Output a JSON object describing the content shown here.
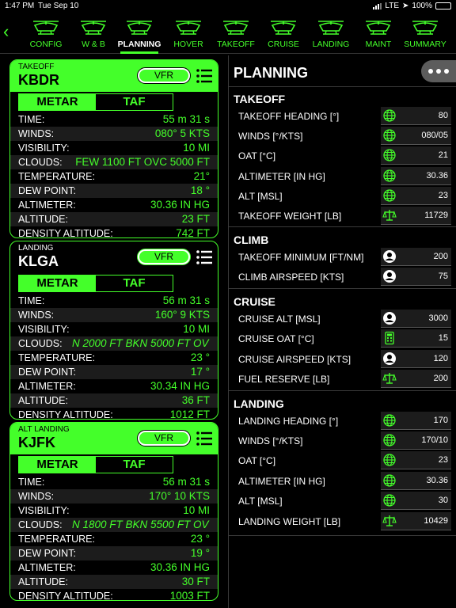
{
  "status": {
    "time": "1:47 PM",
    "date": "Tue Sep 10",
    "network": "LTE",
    "battery": "100%"
  },
  "nav": {
    "tabs": [
      {
        "label": "CONFIG",
        "icon": "helicopter-config-icon"
      },
      {
        "label": "W & B",
        "icon": "helicopter-weight-icon"
      },
      {
        "label": "PLANNING",
        "icon": "helicopter-planning-icon",
        "active": true
      },
      {
        "label": "HOVER",
        "icon": "helicopter-hover-icon"
      },
      {
        "label": "TAKEOFF",
        "icon": "helicopter-takeoff-icon"
      },
      {
        "label": "CRUISE",
        "icon": "helicopter-cruise-icon"
      },
      {
        "label": "LANDING",
        "icon": "helicopter-landing-icon"
      },
      {
        "label": "MAINT",
        "icon": "helicopter-maint-icon"
      },
      {
        "label": "SUMMARY",
        "icon": "helicopter-summary-icon"
      }
    ]
  },
  "weather": {
    "cards": [
      {
        "sub": "TAKEOFF",
        "code": "KBDR",
        "rules": "VFR",
        "metar": "METAR",
        "taf": "TAF",
        "highlight": true,
        "rows": [
          {
            "k": "TIME:",
            "v": "55 m 31 s"
          },
          {
            "k": "WINDS:",
            "v": "080° 5 KTS"
          },
          {
            "k": "VISIBILITY:",
            "v": "10 MI"
          },
          {
            "k": "CLOUDS:",
            "v": "FEW 1100 FT OVC 5000 FT"
          },
          {
            "k": "TEMPERATURE:",
            "v": "21°"
          },
          {
            "k": "DEW POINT:",
            "v": "18 °"
          },
          {
            "k": "ALTIMETER:",
            "v": "30.36 IN HG"
          },
          {
            "k": "ALTITUDE:",
            "v": "23 FT"
          },
          {
            "k": "DENSITY ALTITUDE:",
            "v": "742 FT"
          }
        ]
      },
      {
        "sub": "LANDING",
        "code": "KLGA",
        "rules": "VFR",
        "metar": "METAR",
        "taf": "TAF",
        "highlight": false,
        "rows": [
          {
            "k": "TIME:",
            "v": "56 m 31 s"
          },
          {
            "k": "WINDS:",
            "v": "160° 9 KTS"
          },
          {
            "k": "VISIBILITY:",
            "v": "10 MI"
          },
          {
            "k": "CLOUDS:",
            "v": "N 2000 FT BKN 5000 FT OV"
          },
          {
            "k": "TEMPERATURE:",
            "v": "23 °"
          },
          {
            "k": "DEW POINT:",
            "v": "17 °"
          },
          {
            "k": "ALTIMETER:",
            "v": "30.34 IN HG"
          },
          {
            "k": "ALTITUDE:",
            "v": "36 FT"
          },
          {
            "k": "DENSITY ALTITUDE:",
            "v": "1012 FT"
          }
        ]
      },
      {
        "sub": "ALT LANDING",
        "code": "KJFK",
        "rules": "VFR",
        "metar": "METAR",
        "taf": "TAF",
        "highlight": true,
        "rows": [
          {
            "k": "TIME:",
            "v": "56 m 31 s"
          },
          {
            "k": "WINDS:",
            "v": "170° 10 KTS"
          },
          {
            "k": "VISIBILITY:",
            "v": "10 MI"
          },
          {
            "k": "CLOUDS:",
            "v": "N 1800 FT BKN 5500 FT OV"
          },
          {
            "k": "TEMPERATURE:",
            "v": "23 °"
          },
          {
            "k": "DEW POINT:",
            "v": "19 °"
          },
          {
            "k": "ALTIMETER:",
            "v": "30.36 IN HG"
          },
          {
            "k": "ALTITUDE:",
            "v": "30 FT"
          },
          {
            "k": "DENSITY ALTITUDE:",
            "v": "1003 FT"
          }
        ]
      }
    ]
  },
  "planning": {
    "title": "PLANNING",
    "sections": [
      {
        "title": "TAKEOFF",
        "rows": [
          {
            "k": "TAKEOFF HEADING [°]",
            "v": "80",
            "icon": "globe-icon"
          },
          {
            "k": "WINDS [°/KTS]",
            "v": "080/05",
            "icon": "globe-icon"
          },
          {
            "k": "OAT [°C]",
            "v": "21",
            "icon": "globe-icon"
          },
          {
            "k": "ALTIMETER [IN HG]",
            "v": "30.36",
            "icon": "globe-icon"
          },
          {
            "k": "ALT [MSL]",
            "v": "23",
            "icon": "globe-icon"
          },
          {
            "k": "TAKEOFF WEIGHT [LB]",
            "v": "11729",
            "icon": "scale-icon"
          }
        ]
      },
      {
        "title": "CLIMB",
        "rows": [
          {
            "k": "TAKEOFF MINIMUM [FT/NM]",
            "v": "200",
            "icon": "user-icon"
          },
          {
            "k": "CLIMB AIRSPEED [KTS]",
            "v": "75",
            "icon": "user-icon"
          }
        ]
      },
      {
        "title": "CRUISE",
        "rows": [
          {
            "k": "CRUISE ALT [MSL]",
            "v": "3000",
            "icon": "user-icon"
          },
          {
            "k": "CRUISE OAT [°C]",
            "v": "15",
            "icon": "calculator-icon"
          },
          {
            "k": "CRUISE AIRSPEED [KTS]",
            "v": "120",
            "icon": "user-icon"
          },
          {
            "k": "FUEL RESERVE [LB]",
            "v": "200",
            "icon": "scale-icon"
          }
        ]
      },
      {
        "title": "LANDING",
        "rows": [
          {
            "k": "LANDING HEADING [°]",
            "v": "170",
            "icon": "globe-icon"
          },
          {
            "k": "WINDS [°/KTS]",
            "v": "170/10",
            "icon": "globe-icon"
          },
          {
            "k": "OAT [°C]",
            "v": "23",
            "icon": "globe-icon"
          },
          {
            "k": "ALTIMETER [IN HG]",
            "v": "30.36",
            "icon": "globe-icon"
          },
          {
            "k": "ALT [MSL]",
            "v": "30",
            "icon": "globe-icon"
          },
          {
            "k": "LANDING WEIGHT [LB]",
            "v": "10429",
            "icon": "scale-icon"
          }
        ]
      }
    ]
  },
  "colors": {
    "accent": "#44ff2a",
    "background": "#000000",
    "rowAlt": "#1c1c1c"
  }
}
